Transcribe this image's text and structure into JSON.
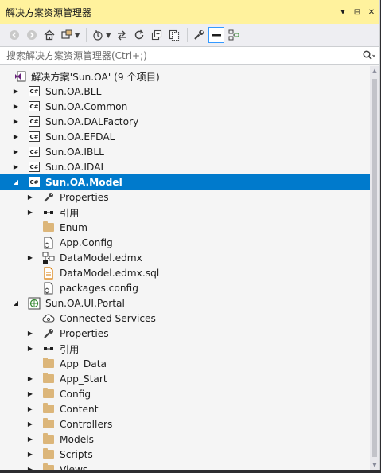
{
  "window": {
    "title": "解决方案资源管理器",
    "pin_glyph": "▾",
    "autohide_glyph": "⊟",
    "close_glyph": "✕"
  },
  "toolbar": {
    "back": "◀",
    "forward": "▶",
    "home": "⌂",
    "switch_views": "▤",
    "pending_changes": "◷",
    "sync": "⇆",
    "refresh": "↻",
    "collapse_all": "⧉",
    "show_all": "⧈",
    "properties": "🔧",
    "preview": "▬",
    "view_class_diagram": "⊞"
  },
  "search": {
    "placeholder": "搜索解决方案资源管理器(Ctrl+;)",
    "icon": "⚲"
  },
  "tree": [
    {
      "label": "解决方案'Sun.OA' (9 个项目)",
      "icon": "solution-icon",
      "expand": "",
      "level": 0
    },
    {
      "label": "Sun.OA.BLL",
      "icon": "csharp-project-icon",
      "expand": "▶",
      "level": 0
    },
    {
      "label": "Sun.OA.Common",
      "icon": "csharp-project-icon",
      "expand": "▶",
      "level": 0
    },
    {
      "label": "Sun.OA.DALFactory",
      "icon": "csharp-project-icon",
      "expand": "▶",
      "level": 0
    },
    {
      "label": "Sun.OA.EFDAL",
      "icon": "csharp-project-icon",
      "expand": "▶",
      "level": 0
    },
    {
      "label": "Sun.OA.IBLL",
      "icon": "csharp-project-icon",
      "expand": "▶",
      "level": 0
    },
    {
      "label": "Sun.OA.IDAL",
      "icon": "csharp-project-icon",
      "expand": "▶",
      "level": 0
    },
    {
      "label": "Sun.OA.Model",
      "icon": "csharp-project-icon",
      "expand": "◢",
      "level": 0,
      "selected": true
    },
    {
      "label": "Properties",
      "icon": "wrench-icon",
      "expand": "▶",
      "level": 1
    },
    {
      "label": "引用",
      "icon": "references-icon",
      "expand": "▶",
      "level": 1
    },
    {
      "label": "Enum",
      "icon": "folder-icon",
      "expand": "",
      "level": 1
    },
    {
      "label": "App.Config",
      "icon": "config-file-icon",
      "expand": "",
      "level": 1
    },
    {
      "label": "DataModel.edmx",
      "icon": "edmx-icon",
      "expand": "▶",
      "level": 1
    },
    {
      "label": "DataModel.edmx.sql",
      "icon": "sql-file-icon",
      "expand": "",
      "level": 1
    },
    {
      "label": "packages.config",
      "icon": "config-file-icon",
      "expand": "",
      "level": 1
    },
    {
      "label": "Sun.OA.UI.Portal",
      "icon": "web-project-icon",
      "expand": "◢",
      "level": 0
    },
    {
      "label": "Connected Services",
      "icon": "cloud-icon",
      "expand": "",
      "level": 1
    },
    {
      "label": "Properties",
      "icon": "wrench-icon",
      "expand": "▶",
      "level": 1
    },
    {
      "label": "引用",
      "icon": "references-icon",
      "expand": "▶",
      "level": 1
    },
    {
      "label": "App_Data",
      "icon": "folder-icon",
      "expand": "",
      "level": 1
    },
    {
      "label": "App_Start",
      "icon": "folder-icon",
      "expand": "▶",
      "level": 1
    },
    {
      "label": "Config",
      "icon": "folder-icon",
      "expand": "▶",
      "level": 1
    },
    {
      "label": "Content",
      "icon": "folder-icon",
      "expand": "▶",
      "level": 1
    },
    {
      "label": "Controllers",
      "icon": "folder-icon",
      "expand": "▶",
      "level": 1
    },
    {
      "label": "Models",
      "icon": "folder-icon",
      "expand": "▶",
      "level": 1
    },
    {
      "label": "Scripts",
      "icon": "folder-icon",
      "expand": "▶",
      "level": 1
    },
    {
      "label": "Views",
      "icon": "folder-icon",
      "expand": "▶",
      "level": 1
    }
  ],
  "colors": {
    "title_bar": "#fff29d",
    "selection": "#007acc",
    "folder": "#dcb67a",
    "vs_purple": "#68217a",
    "sql_orange": "#d97a00"
  }
}
